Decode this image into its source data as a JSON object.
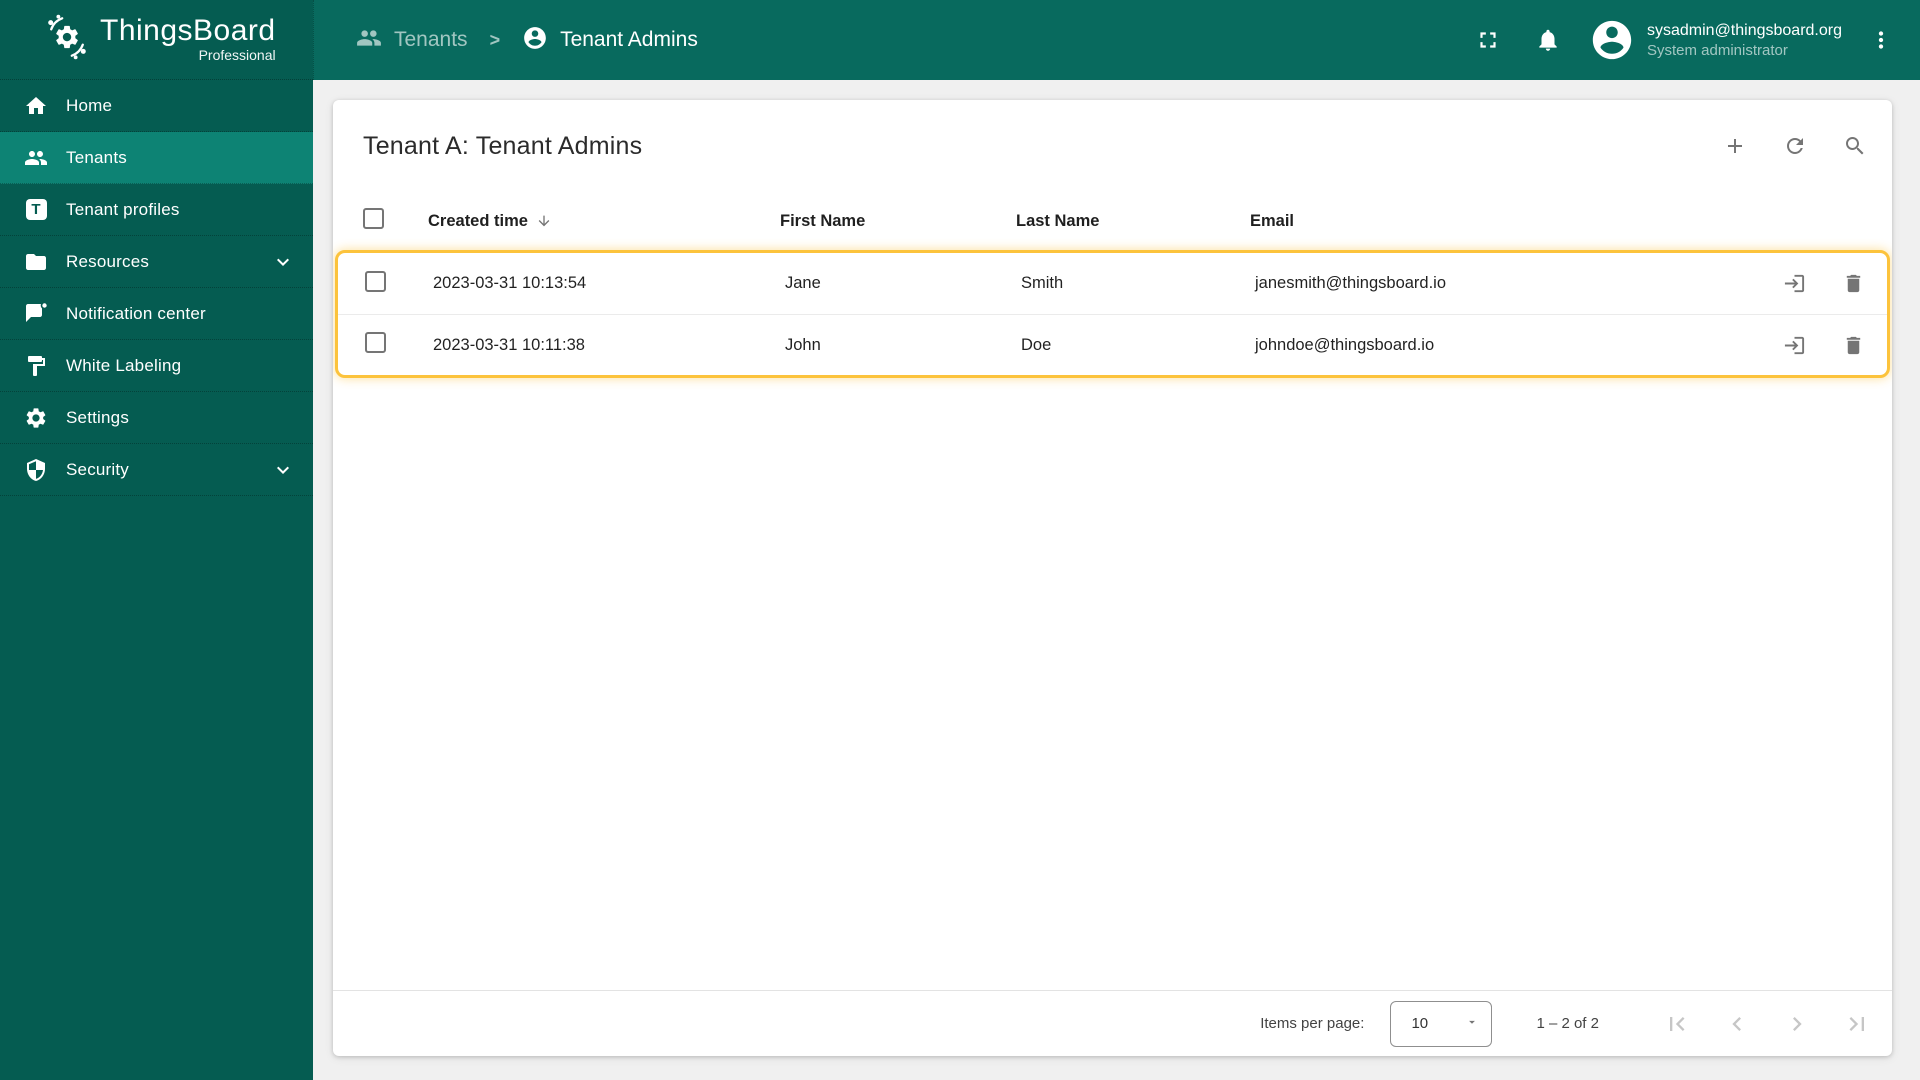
{
  "app": {
    "name": "ThingsBoard",
    "edition": "Professional"
  },
  "topbar": {
    "breadcrumb": {
      "parent": "Tenants",
      "separator": ">",
      "current": "Tenant Admins"
    },
    "user": {
      "email": "sysadmin@thingsboard.org",
      "role": "System administrator"
    }
  },
  "sidebar": {
    "selected": "Tenants",
    "tenant_profiles_glyph": "T",
    "items": [
      {
        "label": "Home"
      },
      {
        "label": "Tenants"
      },
      {
        "label": "Tenant profiles"
      },
      {
        "label": "Resources"
      },
      {
        "label": "Notification center"
      },
      {
        "label": "White Labeling"
      },
      {
        "label": "Settings"
      },
      {
        "label": "Security"
      }
    ]
  },
  "page": {
    "title": "Tenant A: Tenant Admins"
  },
  "table": {
    "columns": {
      "created": "Created time",
      "first": "First Name",
      "last": "Last Name",
      "email": "Email"
    },
    "sort": {
      "column": "Created time",
      "direction": "desc"
    },
    "rows": [
      {
        "created": "2023-03-31 10:13:54",
        "first": "Jane",
        "last": "Smith",
        "email": "janesmith@thingsboard.io"
      },
      {
        "created": "2023-03-31 10:11:38",
        "first": "John",
        "last": "Doe",
        "email": "johndoe@thingsboard.io"
      }
    ],
    "highlight_color": "#fcc33c"
  },
  "paginator": {
    "items_per_page_label": "Items per page:",
    "page_size": "10",
    "range": "1 – 2 of 2"
  },
  "colors": {
    "header_bg": "#086a5e",
    "sidebar_bg": "#055c51",
    "selected_bg": "#0d8374",
    "icon_gray": "#757575"
  }
}
